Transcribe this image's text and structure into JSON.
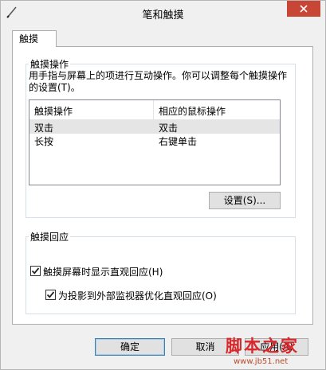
{
  "window": {
    "title": "笔和触摸"
  },
  "tabs": [
    {
      "label": "触摸"
    }
  ],
  "touch_actions": {
    "group_label": "触摸操作",
    "description": "用手指与屏幕上的项进行互动操作。你可以调整每个触摸操作的设置(T)。",
    "columns": [
      "触摸操作",
      "相应的鼠标操作"
    ],
    "rows": [
      {
        "action": "双击",
        "mouse": "双击",
        "selected": true
      },
      {
        "action": "长按",
        "mouse": "右键单击",
        "selected": false
      }
    ],
    "settings_button": "设置(S)..."
  },
  "touch_feedback": {
    "group_label": "触摸回应",
    "show_visual_feedback": {
      "label": "触摸屏幕时显示直观回应(H)",
      "checked": true
    },
    "optimize_for_projection": {
      "label": "为投影到外部监视器优化直观回应(O)",
      "checked": true
    }
  },
  "buttons": {
    "ok": "确定",
    "cancel": "取消",
    "apply": "应用(A)"
  },
  "watermark": {
    "text": "脚本之家",
    "url": "www.jb51.net"
  }
}
